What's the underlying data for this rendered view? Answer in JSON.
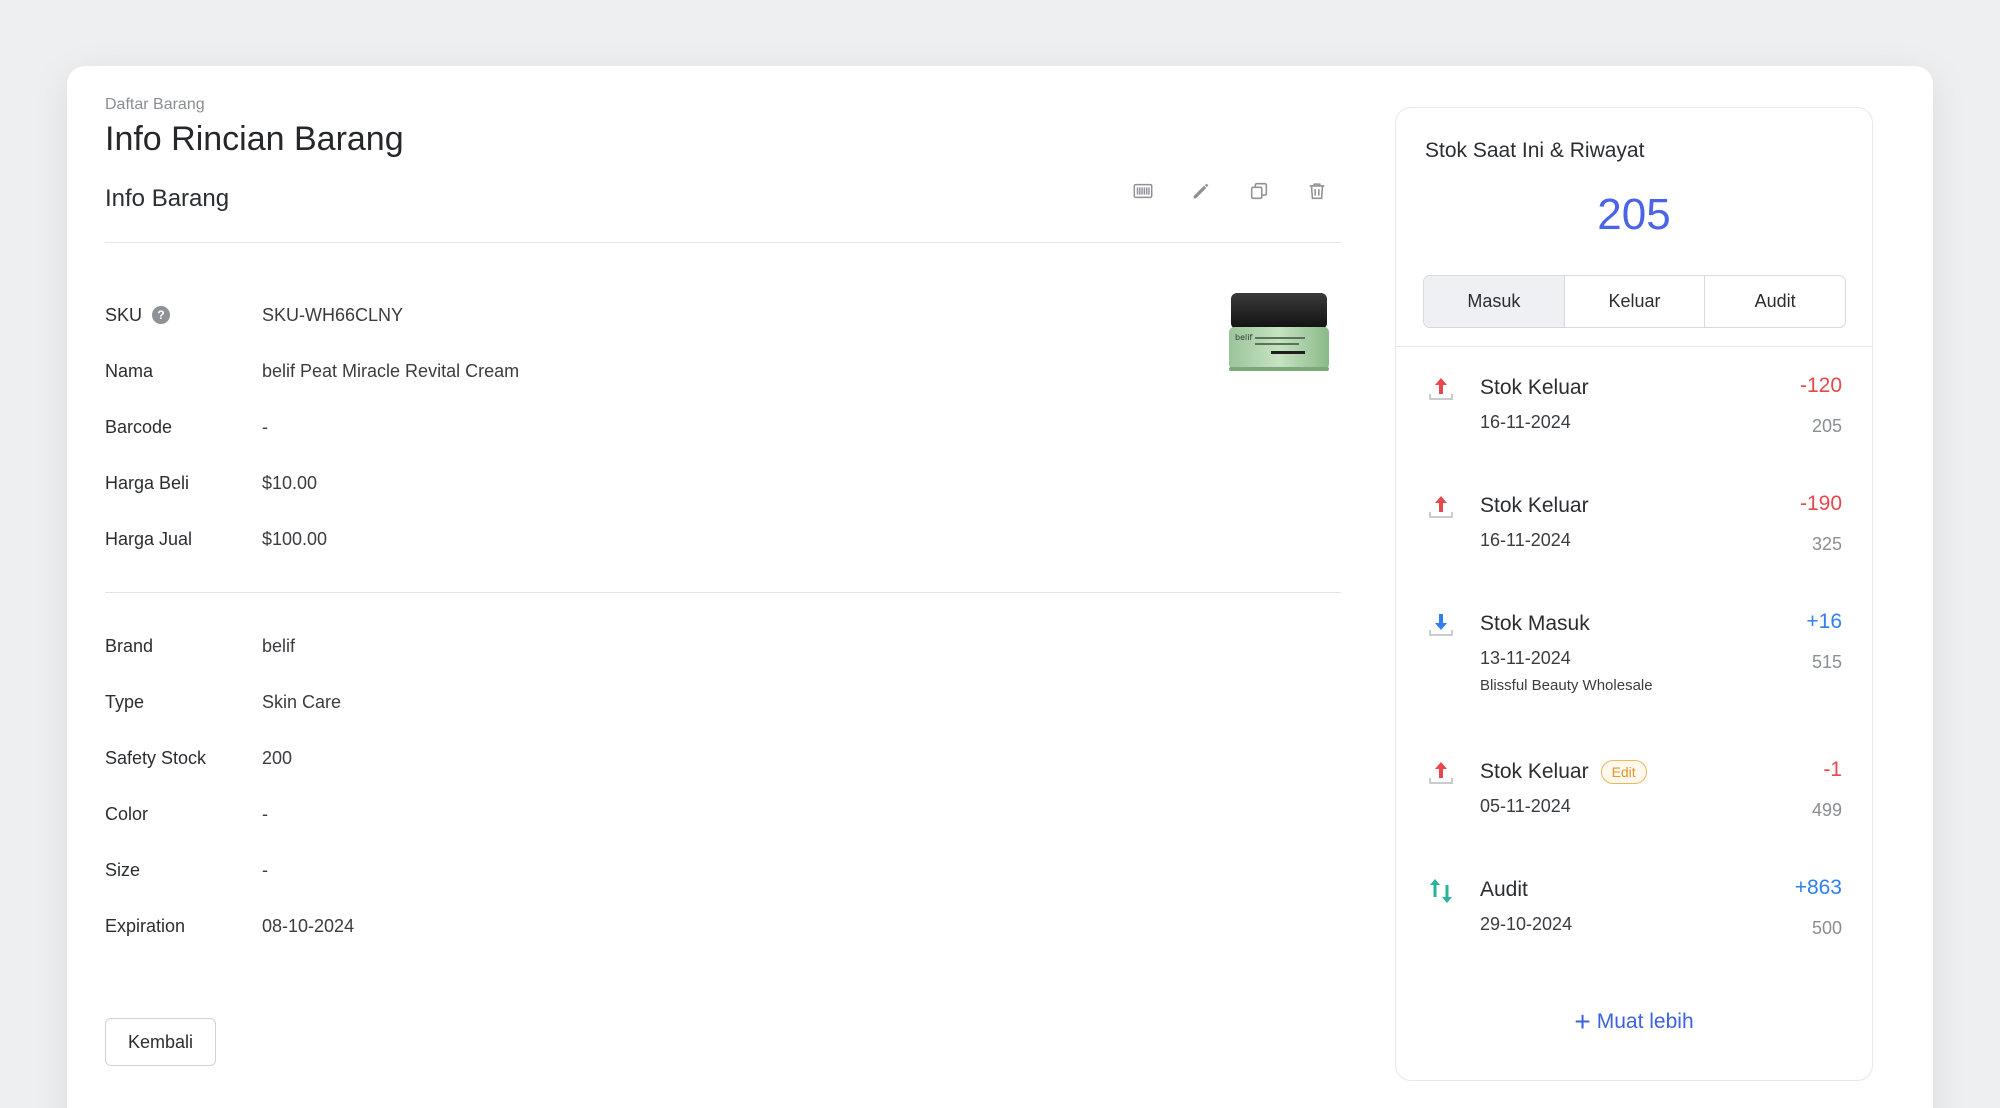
{
  "header": {
    "breadcrumb": "Daftar Barang",
    "title": "Info Rincian Barang"
  },
  "section": {
    "title": "Info Barang",
    "toolbar_icons": [
      "barcode-icon",
      "pencil-icon",
      "copy-icon",
      "trash-icon"
    ]
  },
  "fields_primary": [
    {
      "label": "SKU",
      "value": "SKU-WH66CLNY"
    },
    {
      "label": "Nama",
      "value": "belif Peat Miracle Revital Cream"
    },
    {
      "label": "Barcode",
      "value": "-"
    },
    {
      "label": "Harga Beli",
      "value": "$10.00"
    },
    {
      "label": "Harga Jual",
      "value": "$100.00"
    }
  ],
  "fields_secondary": [
    {
      "label": "Brand",
      "value": "belif"
    },
    {
      "label": "Type",
      "value": "Skin Care"
    },
    {
      "label": "Safety Stock",
      "value": "200"
    },
    {
      "label": "Color",
      "value": "-"
    },
    {
      "label": "Size",
      "value": "-"
    },
    {
      "label": "Expiration",
      "value": "08-10-2024"
    }
  ],
  "product_image": {
    "label": "belif"
  },
  "back_button": "Kembali",
  "stock": {
    "title": "Stok Saat Ini & Riwayat",
    "current": "205",
    "tabs": [
      "Masuk",
      "Keluar",
      "Audit"
    ],
    "active_tab": "Masuk",
    "history": [
      {
        "title": "Stok Keluar",
        "delta": "-120",
        "date": "16-11-2024",
        "balance": "205",
        "icon": "arrow-up-icon"
      },
      {
        "title": "Stok Keluar",
        "delta": "-190",
        "date": "16-11-2024",
        "balance": "325",
        "icon": "arrow-up-icon"
      },
      {
        "title": "Stok Masuk",
        "delta": "+16",
        "date": "13-11-2024",
        "balance": "515",
        "note": "Blissful Beauty Wholesale",
        "icon": "arrow-down-icon"
      },
      {
        "title": "Stok Keluar",
        "badge": "Edit",
        "delta": "-1",
        "date": "05-11-2024",
        "balance": "499",
        "icon": "arrow-up-icon"
      },
      {
        "title": "Audit",
        "delta": "+863",
        "date": "29-10-2024",
        "balance": "500",
        "icon": "swap-arrows-icon"
      }
    ],
    "load_more": "Muat lebih"
  },
  "colors": {
    "accent": "#4a64e8",
    "negative": "#e5484d",
    "positive": "#2f80ed",
    "audit": "#2bb39a",
    "badge": "#e0962a"
  }
}
